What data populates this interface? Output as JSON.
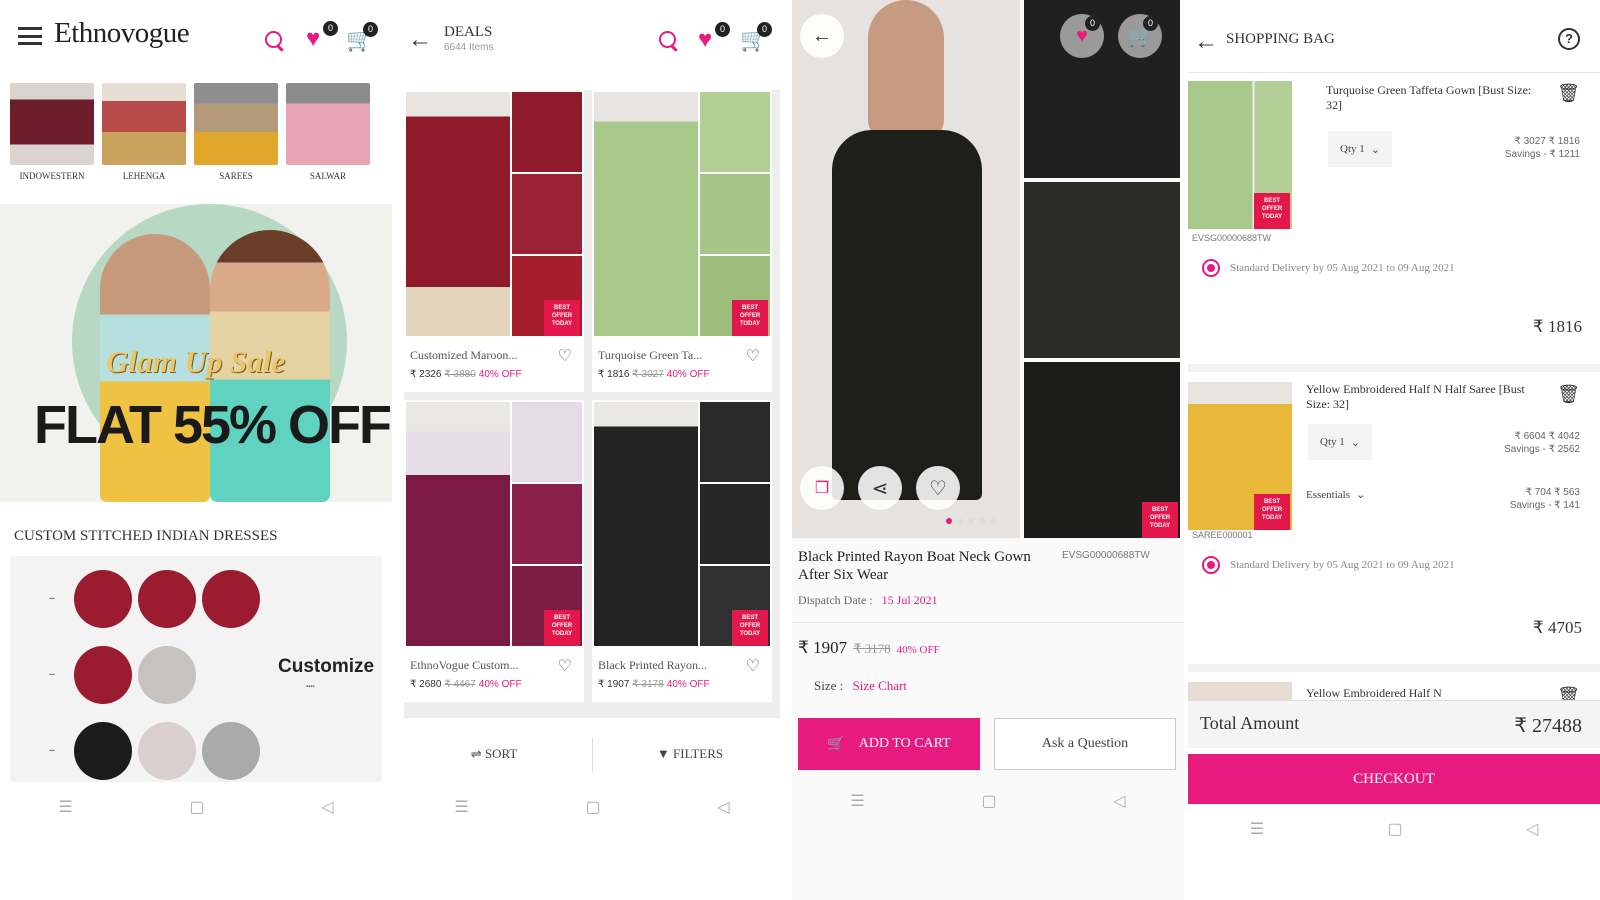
{
  "home": {
    "logo_text": "Ethnovogue",
    "wishlist_count": "0",
    "cart_count": "0",
    "categories": [
      {
        "label": "INDOWESTERN"
      },
      {
        "label": "LEHENGA"
      },
      {
        "label": "SAREES"
      },
      {
        "label": "SALWAR"
      }
    ],
    "banner": {
      "line1": "Glam Up Sale",
      "line2": "FLAT 55% OFF"
    },
    "custom_heading": "CUSTOM STITCHED INDIAN DRESSES",
    "customize_label": "Customize"
  },
  "deals": {
    "title": "DEALS",
    "item_count": "6644 Items",
    "wishlist_count": "0",
    "cart_count": "0",
    "products": [
      {
        "name": "Customized Maroon...",
        "price": "₹ 2326",
        "old_price": "₹ 3880",
        "discount": "40% OFF"
      },
      {
        "name": "Turquoise Green Ta...",
        "price": "₹ 1816",
        "old_price": "₹ 3027",
        "discount": "40% OFF"
      },
      {
        "name": "EthnoVogue Custom...",
        "price": "₹ 2680",
        "old_price": "₹ 4467",
        "discount": "40% OFF"
      },
      {
        "name": "Black Printed Rayon...",
        "price": "₹ 1907",
        "old_price": "₹ 3178",
        "discount": "40% OFF"
      }
    ],
    "sort_label": "SORT",
    "filters_label": "FILTERS"
  },
  "product": {
    "title": "Black Printed Rayon Boat Neck Gown After Six Wear",
    "sku": "EVSG00000688TW",
    "dispatch_label": "Dispatch Date :",
    "dispatch_date": "15 Jul 2021",
    "price": "₹ 1907",
    "old_price": "₹ 3178",
    "discount": "40% OFF",
    "size_label": "Size :",
    "size_chart": "Size Chart",
    "add_to_cart": "ADD TO CART",
    "ask_question": "Ask a Question",
    "wishlist_count": "0",
    "cart_count": "0"
  },
  "bag": {
    "title": "SHOPPING BAG",
    "items": [
      {
        "name": "Turquoise Green Taffeta Gown [Bust Size: 32]",
        "qty": "Qty 1",
        "price_line": "₹ 3027  ₹ 1816",
        "savings": "Savings - ₹ 1211",
        "sku": "EVSG00000688TW",
        "delivery": "Standard Delivery by 05 Aug 2021 to 09 Aug 2021",
        "total": "₹ 1816"
      },
      {
        "name": "Yellow Embroidered Half N Half Saree [Bust Size: 32]",
        "qty": "Qty 1",
        "price_line": "₹ 6604  ₹ 4042",
        "savings": "Savings - ₹ 2562",
        "essentials": "Essentials",
        "ess_price": "₹ 704  ₹ 563",
        "ess_savings": "Savings - ₹ 141",
        "sku": "SAREE000001",
        "delivery": "Standard Delivery by 05 Aug 2021 to 09 Aug 2021",
        "total": "₹ 4705"
      },
      {
        "name": "Yellow Embroidered Half N"
      }
    ],
    "total_label": "Total Amount",
    "total_value": "₹ 27488",
    "checkout": "CHECKOUT"
  }
}
